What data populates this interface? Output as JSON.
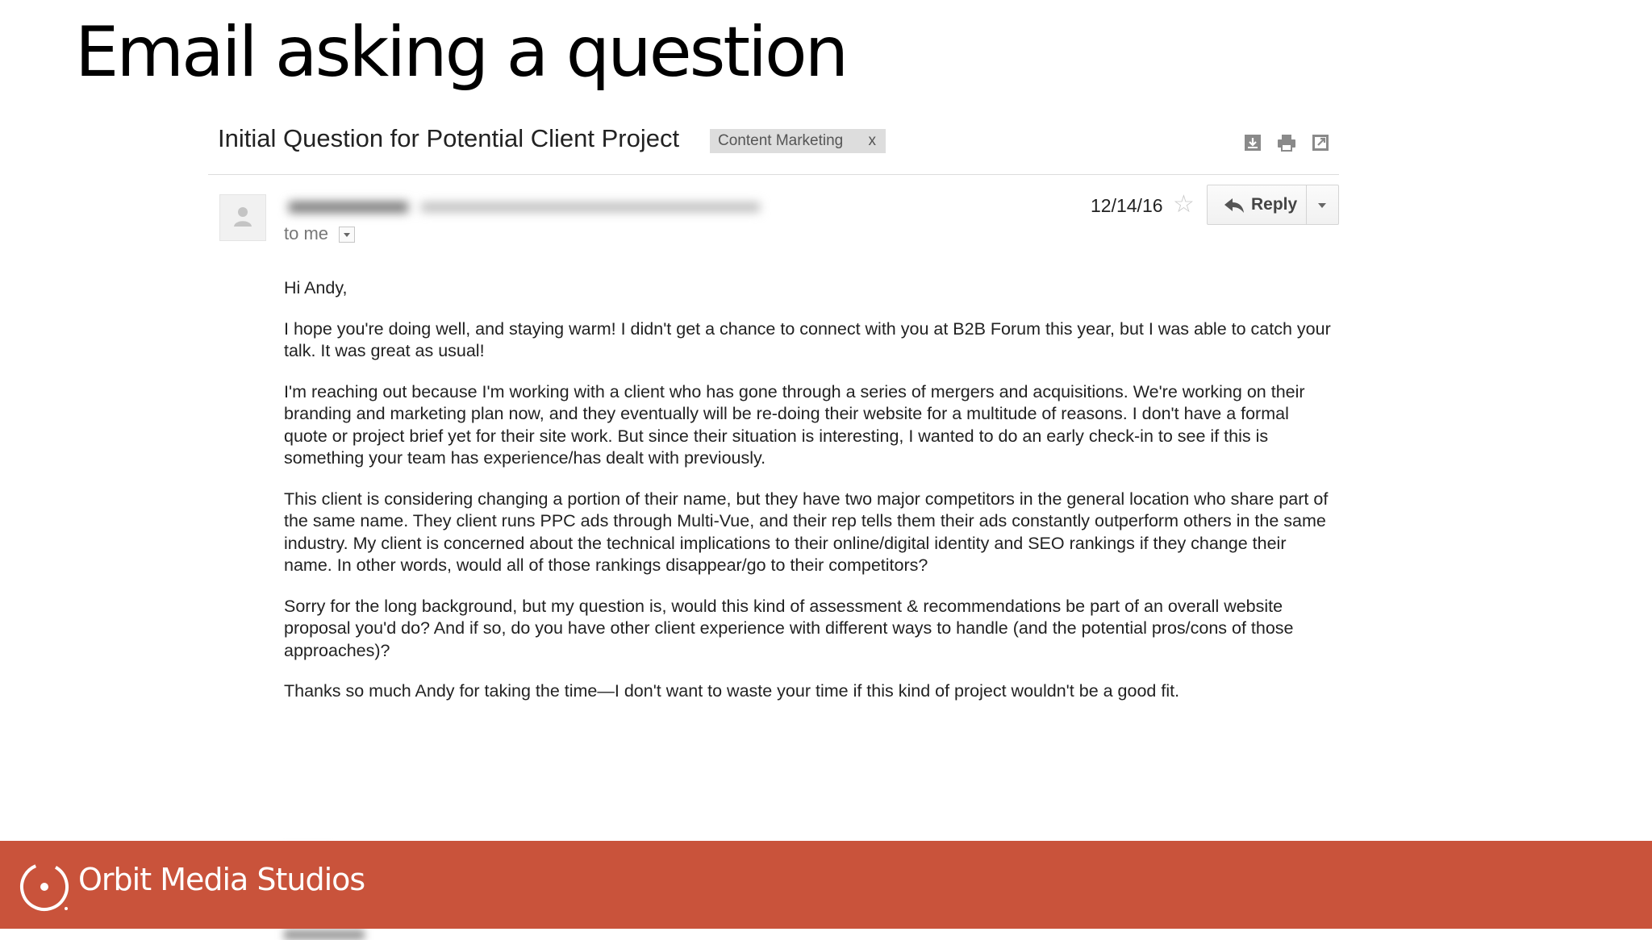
{
  "slide": {
    "title": "Email asking a question"
  },
  "email": {
    "subject": "Initial Question for Potential Client Project",
    "label": "Content Marketing",
    "label_remove": "x",
    "toolbar_icons": [
      "download-icon",
      "print-icon",
      "new-window-icon"
    ],
    "recipient": "to me",
    "date": "12/14/16",
    "reply_label": "Reply",
    "body": {
      "greeting": "Hi Andy,",
      "paragraphs": [
        "I hope you're doing well, and staying warm! I didn't get a chance to connect with you at B2B Forum this year, but I was able to catch your talk. It was great as usual!",
        "I'm reaching out because I'm working with a client who has gone through a series of mergers and acquisitions. We're working on their branding and marketing plan now, and they eventually will be re-doing their website for a multitude of reasons. I don't have a formal quote or project brief yet for their site work. But since their situation is interesting, I wanted to do an early check-in to see if this is something your team has experience/has dealt with previously.",
        "This client is considering changing a portion of their name, but they have two major competitors in the general location who share part of the same name. They client runs PPC ads through Multi-Vue, and their rep tells them their ads constantly outperform others in the same industry. My client is concerned about the technical implications to their online/digital identity and SEO rankings if they change their name. In other words, would all of those rankings disappear/go to their competitors?",
        "Sorry for the long background, but my question is, would this kind of assessment & recommendations be part of an overall website proposal you'd do? And if so, do you have other client experience with different ways to handle (and the potential pros/cons of those approaches)?",
        "Thanks so much Andy for taking the time—I don't want to waste your time if this kind of project wouldn't be a good fit."
      ]
    }
  },
  "footer": {
    "brand": "Orbit Media Studios",
    "bar_color": "#c9533b"
  }
}
